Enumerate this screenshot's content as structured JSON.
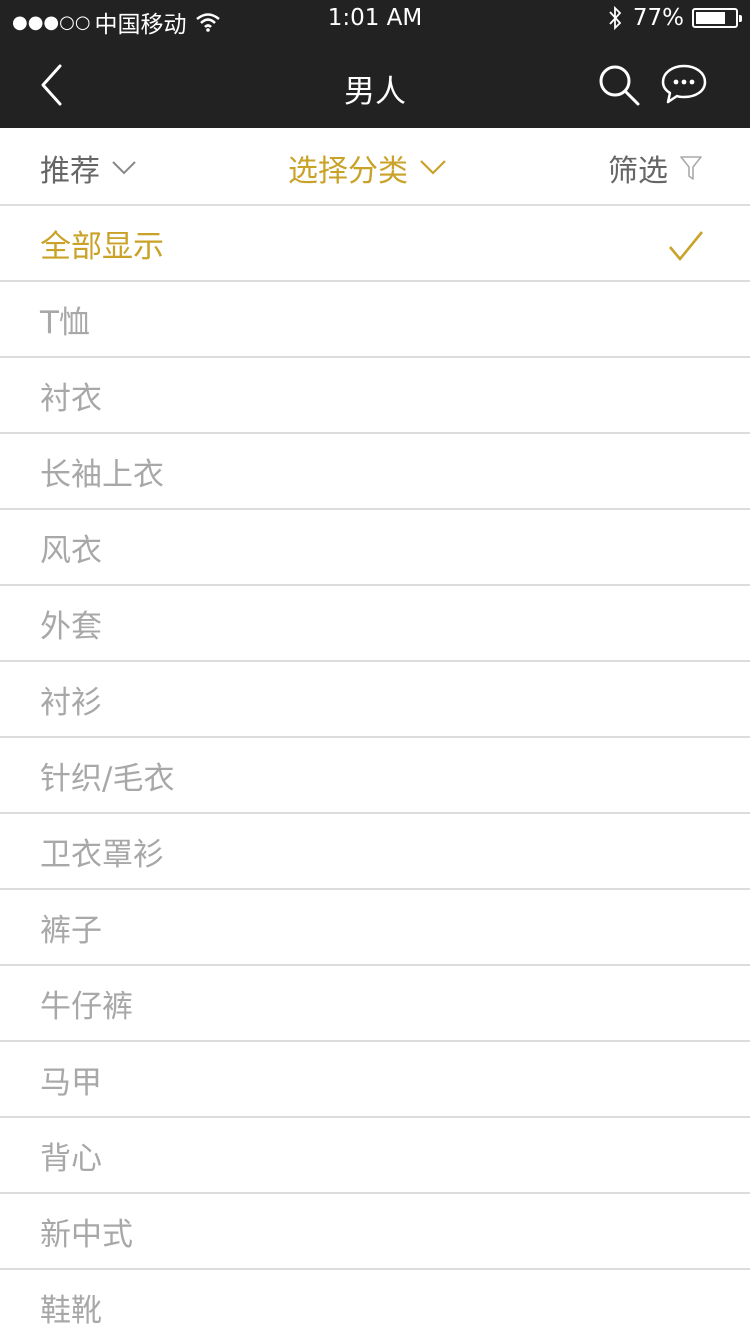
{
  "status": {
    "signal": "●●●○○",
    "carrier": "中国移动",
    "time": "1:01 AM",
    "battery": "77%",
    "battery_level": 0.77
  },
  "nav": {
    "title": "男人",
    "back_icon": "chevron-left-icon",
    "search_icon": "search-icon",
    "message_icon": "chat-bubble-icon"
  },
  "filters": {
    "sort_label": "推荐",
    "category_label": "选择分类",
    "filter_label": "筛选"
  },
  "categories": [
    "全部显示",
    "T恤",
    "衬衣",
    "长袖上衣",
    "风衣",
    "外套",
    "衬衫",
    "针织/毛衣",
    "卫衣罩衫",
    "裤子",
    "牛仔裤",
    "马甲",
    "背心",
    "新中式",
    "鞋靴"
  ],
  "selected_index": 0,
  "colors": {
    "accent": "#c9a227",
    "header_bg": "#222222",
    "inactive_text": "#a8a8a8",
    "divider": "#dcdcdc"
  }
}
